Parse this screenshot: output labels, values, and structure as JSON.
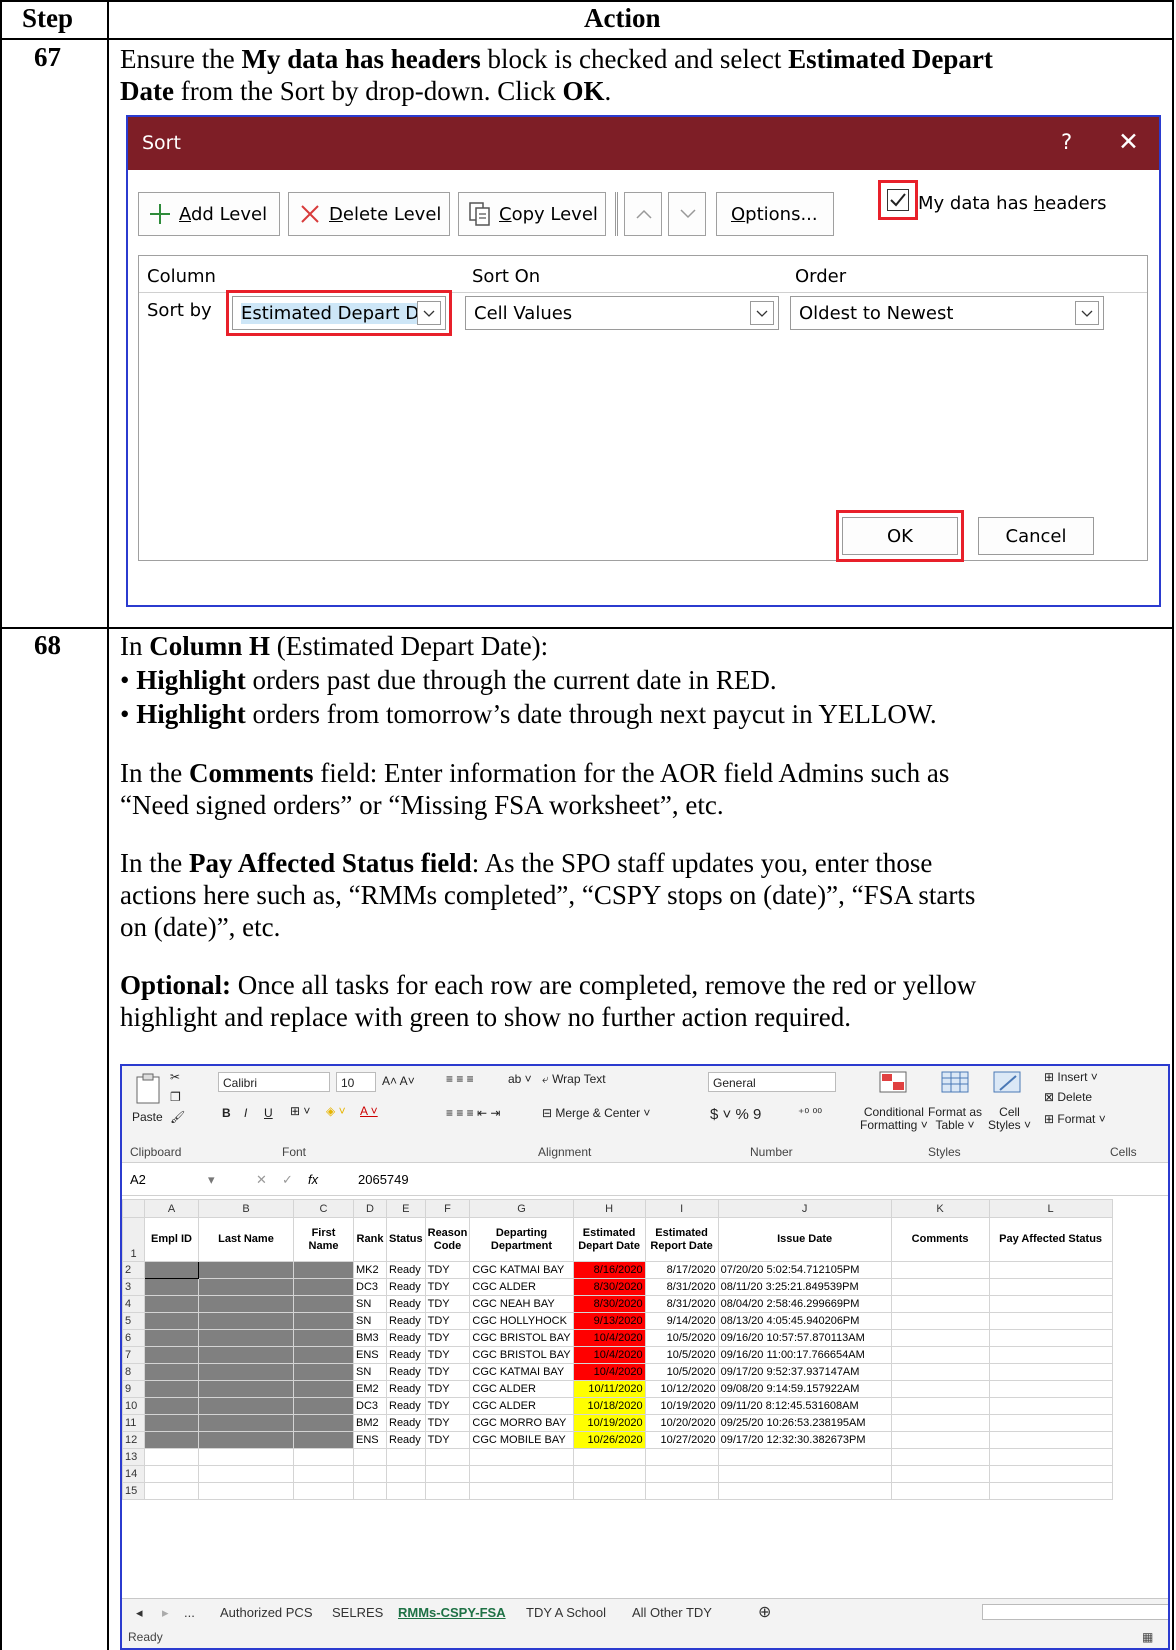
{
  "table": {
    "col_step": "Step",
    "col_action": "Action",
    "rows": [
      {
        "step": "67",
        "text_pre_1": "Ensure the ",
        "bold_1": "My data has headers",
        "text_mid_1": " block is checked and select ",
        "bold_2": "Estimated Depart",
        "bold_3": "Date",
        "text_mid_2": " from the Sort by drop-down.  Click ",
        "bold_4": "OK",
        "text_end": "."
      },
      {
        "step": "68",
        "intro_pre": "In ",
        "intro_bold": "Column H",
        "intro_post": " (Estimated Depart Date):",
        "bullet1_bold": "Highlight",
        "bullet1_text": " orders past due through the current date in RED.",
        "bullet2_bold": "Highlight",
        "bullet2_text": " orders from tomorrow’s date through next paycut in YELLOW.",
        "comments_pre": "In the ",
        "comments_bold": "Comments",
        "comments_l1": " field:  Enter information for the AOR field Admins such as",
        "comments_l2": "“Need signed orders” or “Missing FSA worksheet”, etc.",
        "pay_pre": "In the ",
        "pay_bold": "Pay Affected Status field",
        "pay_l1": ":  As the SPO staff updates you, enter those",
        "pay_l2": "actions here such as, “RMMs completed”, “CSPY stops on (date)”, “FSA starts",
        "pay_l3": "on (date)”, etc.",
        "opt_bold": "Optional:",
        "opt_l1": "  Once all tasks for each row are completed, remove the red or yellow",
        "opt_l2": "highlight and replace with green to show no further action required."
      }
    ]
  },
  "sort_dialog": {
    "title": "Sort",
    "help": "?",
    "close": "✕",
    "add_level_pre": "",
    "add_level_u": "A",
    "add_level_post": "dd Level",
    "delete_level_u": "D",
    "delete_level_post": "elete Level",
    "copy_level_u": "C",
    "copy_level_post": "opy Level",
    "options_u": "O",
    "options_post": "ptions...",
    "headers_pre": "My data has ",
    "headers_u": "h",
    "headers_post": "eaders",
    "headers_checked": true,
    "col_column": "Column",
    "col_sort_on": "Sort On",
    "col_order": "Order",
    "sort_by": "Sort by",
    "column_value": "Estimated Depart Da",
    "sort_on_value": "Cell Values",
    "order_value": "Oldest to Newest",
    "ok": "OK",
    "cancel": "Cancel",
    "highlight_color": "#e8202a",
    "title_bar_color": "#7e1e26"
  },
  "excel": {
    "ribbon": {
      "paste": "Paste",
      "font_name": "Calibri",
      "font_size": "10",
      "bold": "B",
      "italic": "I",
      "underline": "U",
      "wrap_text": "Wrap Text",
      "merge_center": "Merge & Center",
      "number_format": "General",
      "currency": "$",
      "percent": "%",
      "comma": "9",
      "conditional_1": "Conditional",
      "conditional_2": "Formatting",
      "format_as_1": "Format as",
      "format_as_2": "Table",
      "cell_styles_1": "Cell",
      "cell_styles_2": "Styles",
      "insert": "Insert",
      "delete": "Delete",
      "format": "Format",
      "groups": [
        "Clipboard",
        "Font",
        "Alignment",
        "Number",
        "Styles",
        "Cells"
      ]
    },
    "name_box": "A2",
    "fx": "fx",
    "formula": "2065749",
    "columns": [
      "A",
      "B",
      "C",
      "D",
      "E",
      "F",
      "G",
      "H",
      "I",
      "J",
      "K",
      "L"
    ],
    "headers": [
      "Empl ID",
      "Last Name",
      "First Name",
      "Rank",
      "Status",
      "Reason Code",
      "Departing Department",
      "Estimated Depart Date",
      "Estimated Report Date",
      "Issue Date",
      "Comments",
      "Pay Affected Status"
    ],
    "rows": [
      {
        "n": "2",
        "rank": "MK2",
        "status": "Ready",
        "code": "TDY",
        "dept": "CGC KATMAI BAY",
        "depart": "8/16/2020",
        "hl": "red",
        "report": "8/17/2020",
        "issue": "07/20/20 5:02:54.712105PM"
      },
      {
        "n": "3",
        "rank": "DC3",
        "status": "Ready",
        "code": "TDY",
        "dept": "CGC ALDER",
        "depart": "8/30/2020",
        "hl": "red",
        "report": "8/31/2020",
        "issue": "08/11/20 3:25:21.849539PM"
      },
      {
        "n": "4",
        "rank": "SN",
        "status": "Ready",
        "code": "TDY",
        "dept": "CGC NEAH BAY",
        "depart": "8/30/2020",
        "hl": "red",
        "report": "8/31/2020",
        "issue": "08/04/20 2:58:46.299669PM"
      },
      {
        "n": "5",
        "rank": "SN",
        "status": "Ready",
        "code": "TDY",
        "dept": "CGC HOLLYHOCK",
        "depart": "9/13/2020",
        "hl": "red",
        "report": "9/14/2020",
        "issue": "08/13/20 4:05:45.940206PM"
      },
      {
        "n": "6",
        "rank": "BM3",
        "status": "Ready",
        "code": "TDY",
        "dept": "CGC BRISTOL BAY",
        "depart": "10/4/2020",
        "hl": "red",
        "report": "10/5/2020",
        "issue": "09/16/20 10:57:57.870113AM"
      },
      {
        "n": "7",
        "rank": "ENS",
        "status": "Ready",
        "code": "TDY",
        "dept": "CGC BRISTOL BAY",
        "depart": "10/4/2020",
        "hl": "red",
        "report": "10/5/2020",
        "issue": "09/16/20 11:00:17.766654AM"
      },
      {
        "n": "8",
        "rank": "SN",
        "status": "Ready",
        "code": "TDY",
        "dept": "CGC KATMAI BAY",
        "depart": "10/4/2020",
        "hl": "red",
        "report": "10/5/2020",
        "issue": "09/17/20 9:52:37.937147AM"
      },
      {
        "n": "9",
        "rank": "EM2",
        "status": "Ready",
        "code": "TDY",
        "dept": "CGC ALDER",
        "depart": "10/11/2020",
        "hl": "yellow",
        "report": "10/12/2020",
        "issue": "09/08/20 9:14:59.157922AM"
      },
      {
        "n": "10",
        "rank": "DC3",
        "status": "Ready",
        "code": "TDY",
        "dept": "CGC ALDER",
        "depart": "10/18/2020",
        "hl": "yellow",
        "report": "10/19/2020",
        "issue": "09/11/20 8:12:45.531608AM"
      },
      {
        "n": "11",
        "rank": "BM2",
        "status": "Ready",
        "code": "TDY",
        "dept": "CGC MORRO BAY",
        "depart": "10/19/2020",
        "hl": "yellow",
        "report": "10/20/2020",
        "issue": "09/25/20 10:26:53.238195AM"
      },
      {
        "n": "12",
        "rank": "ENS",
        "status": "Ready",
        "code": "TDY",
        "dept": "CGC MOBILE BAY",
        "depart": "10/26/2020",
        "hl": "yellow",
        "report": "10/27/2020",
        "issue": "09/17/20 12:32:30.382673PM"
      }
    ],
    "empty_rows": [
      "13",
      "14",
      "15"
    ],
    "tabs": [
      "...",
      "Authorized PCS",
      "SELRES",
      "RMMs-CSPY-FSA",
      "TDY A School",
      "All Other TDY"
    ],
    "active_tab": "RMMs-CSPY-FSA",
    "status": "Ready",
    "colors": {
      "red": "#ff0000",
      "yellow": "#ffff00",
      "redacted": "#808080"
    }
  }
}
